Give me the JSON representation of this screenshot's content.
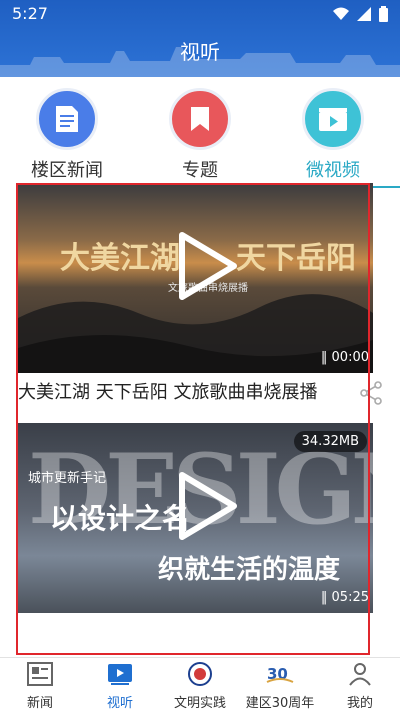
{
  "status": {
    "time": "5:27"
  },
  "header": {
    "title": "视听"
  },
  "categories": [
    {
      "label": "楼区新闻"
    },
    {
      "label": "专题"
    },
    {
      "label": "微视频"
    }
  ],
  "videos": [
    {
      "overlay_title_left": "大美江湖",
      "overlay_title_right": "天下岳阳",
      "overlay_subtitle": "文旅歌曲串烧展播",
      "duration": "00:00",
      "caption": "大美江湖 天下岳阳 文旅歌曲串烧展播"
    },
    {
      "size": "34.32MB",
      "overlay_big": "DESIGN",
      "overlay_small": "城市更新手记",
      "overlay_line1": "以设计之名",
      "overlay_line2": "织就生活的温度",
      "duration": "05:25"
    }
  ],
  "tabs": [
    {
      "label": "新闻"
    },
    {
      "label": "视听"
    },
    {
      "label": "文明实践"
    },
    {
      "label": "建区30周年"
    },
    {
      "label": "我的"
    }
  ],
  "colors": {
    "header": "#1f5fc2",
    "accent": "#2aa9c5",
    "active_tab": "#1f6fd0",
    "highlight_box": "#e0262c"
  }
}
